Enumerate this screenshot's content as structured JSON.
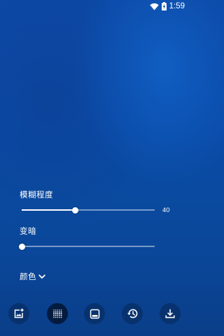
{
  "status_bar": {
    "time": "1:59"
  },
  "controls": {
    "blur": {
      "label": "模糊程度",
      "value": "40",
      "fraction": 0.4
    },
    "dim": {
      "label": "变暗",
      "fraction": 0.0
    },
    "color": {
      "label": "颜色"
    }
  },
  "toolbar": {
    "buttons": [
      {
        "icon": "add-photo-icon"
      },
      {
        "icon": "dot-grid-icon",
        "active": true
      },
      {
        "icon": "bottom-panel-icon"
      },
      {
        "icon": "history-icon"
      },
      {
        "icon": "download-icon"
      }
    ]
  },
  "colors": {
    "accent": "#ffffff",
    "background": "#0a4aa8"
  }
}
